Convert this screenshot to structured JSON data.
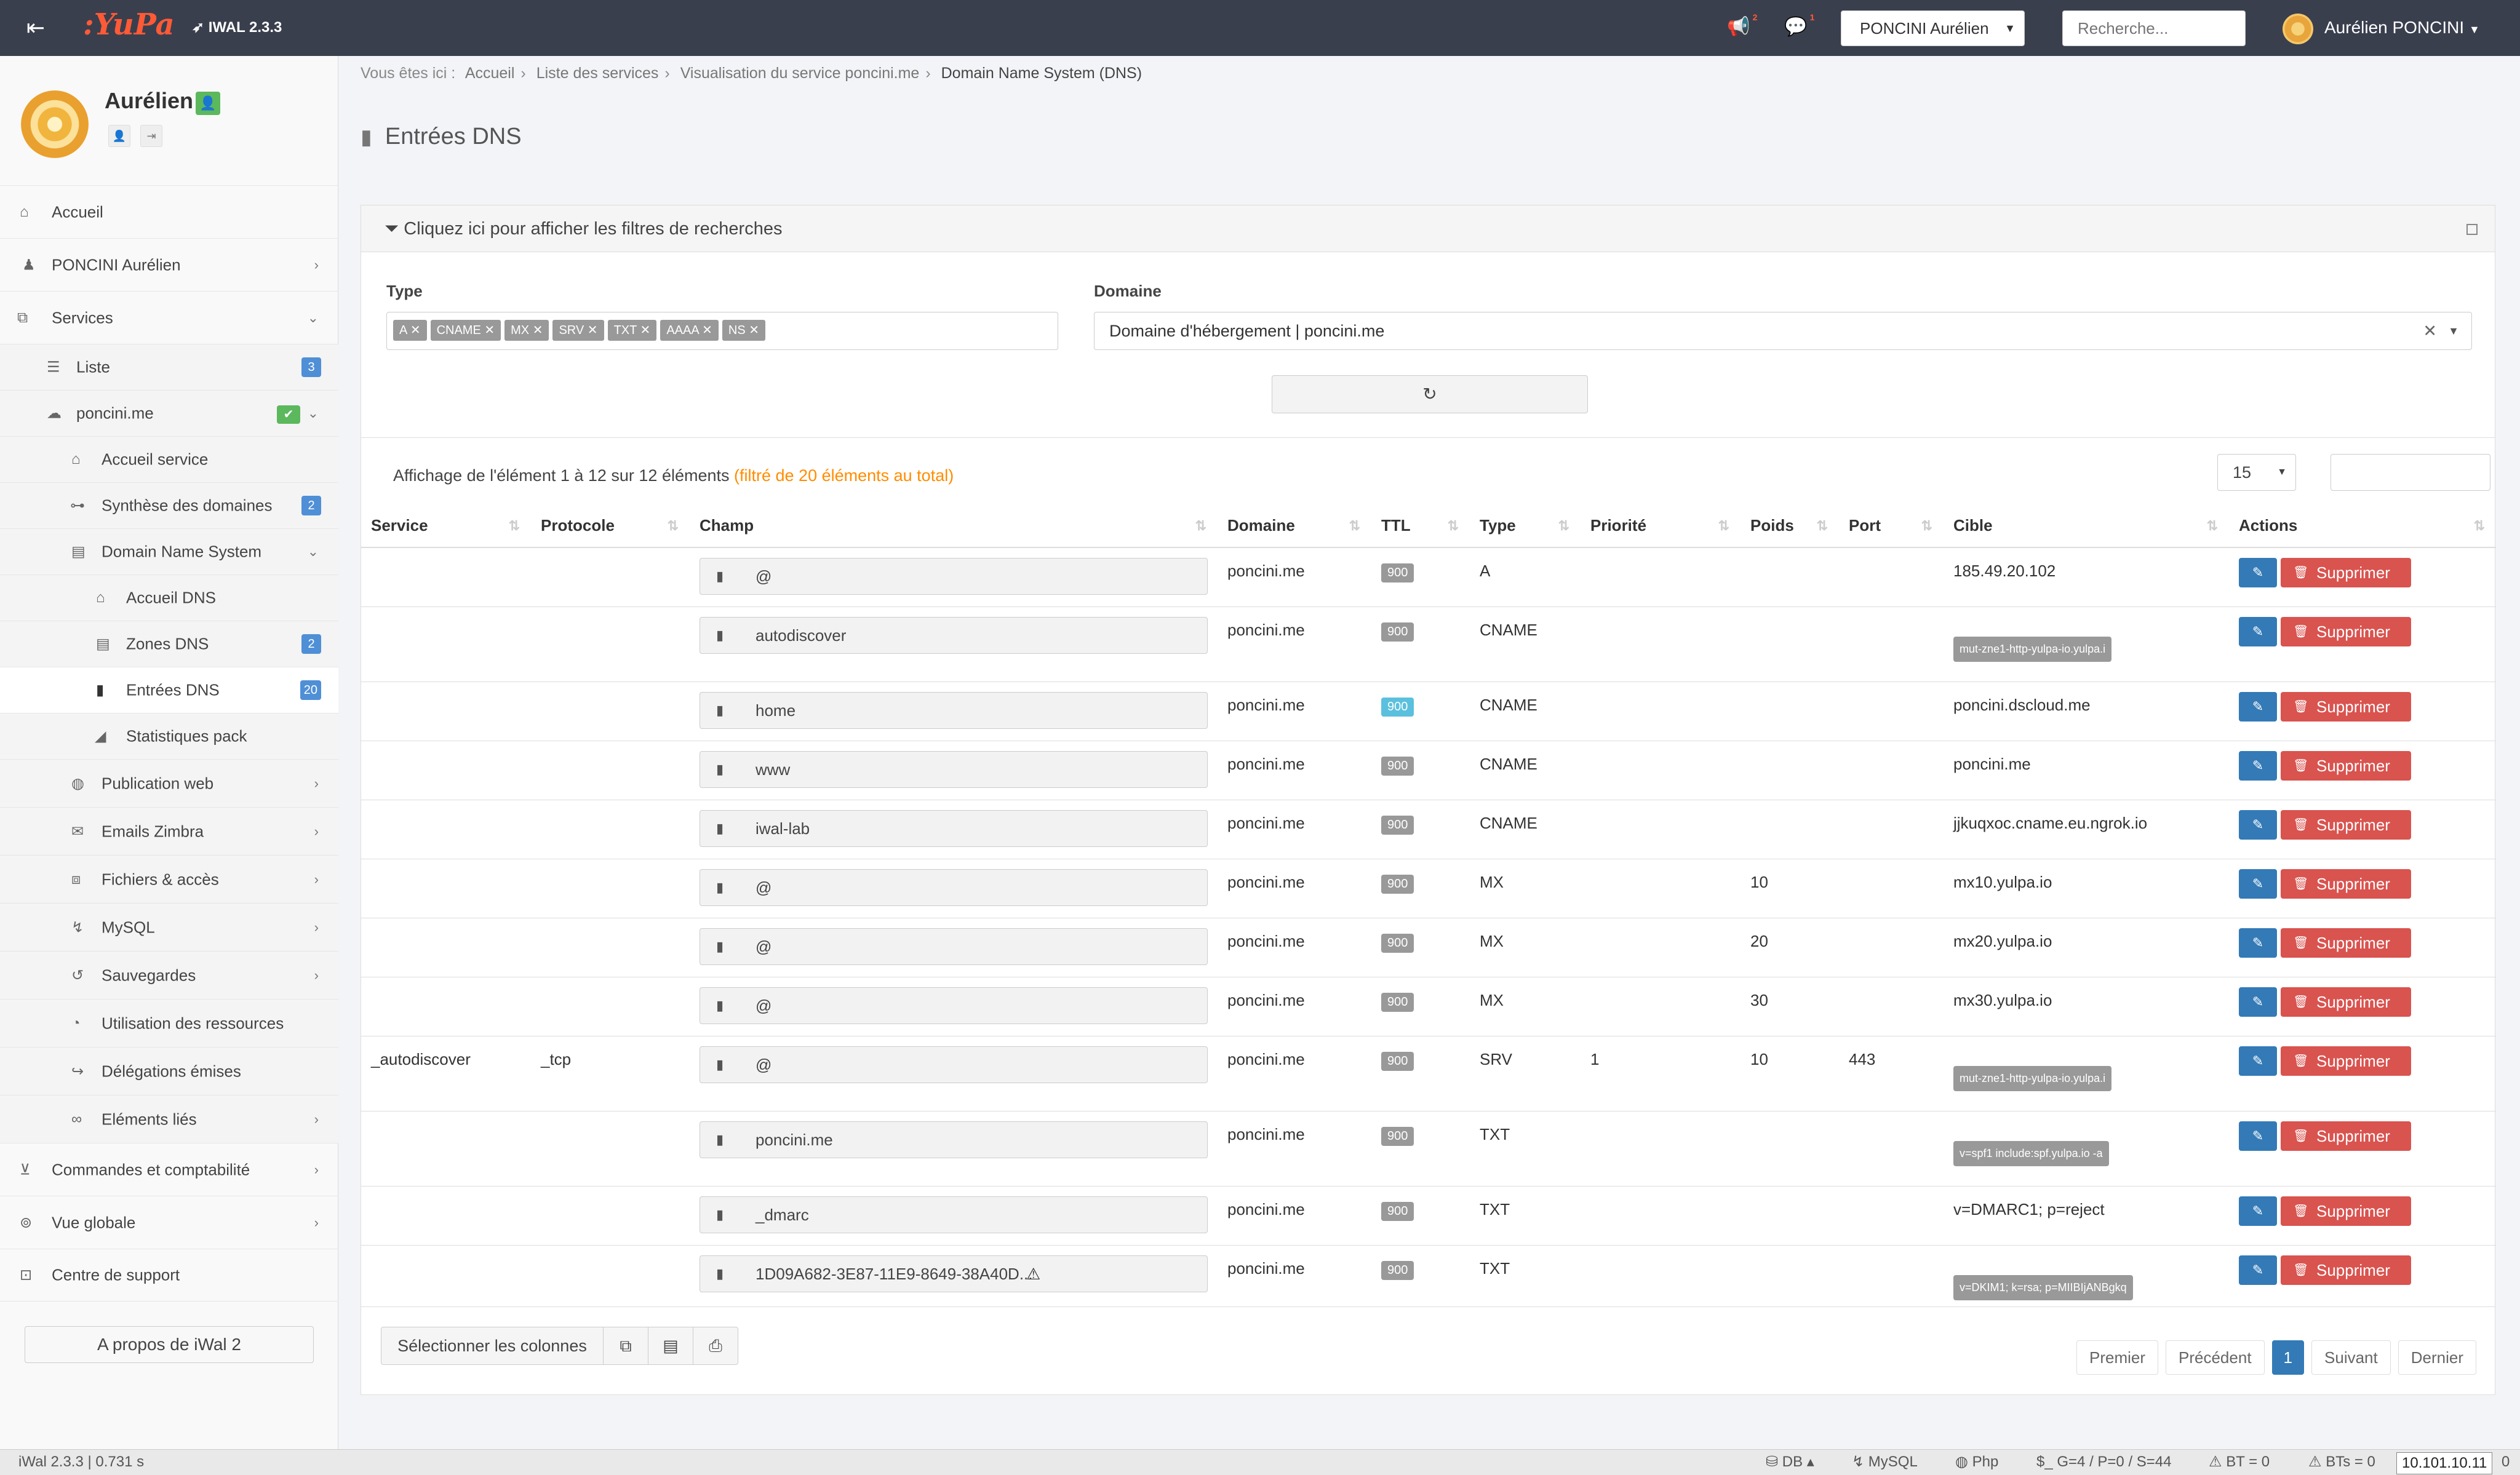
{
  "header": {
    "logo": ":YuPa",
    "version": "IWAL 2.3.3",
    "notif_count": "2",
    "chat_count": "1",
    "account_select": "PONCINI Aurélien",
    "search_placeholder": "Recherche...",
    "user_name": "Aurélien PONCINI"
  },
  "sidebar": {
    "profile_name": "Aurélien",
    "items": {
      "accueil": "Accueil",
      "poncini": "PONCINI Aurélien",
      "services": "Services",
      "liste": "Liste",
      "liste_count": "3",
      "poncinime": "poncini.me",
      "accueil_service": "Accueil service",
      "synthese": "Synthèse des domaines",
      "synthese_count": "2",
      "dns": "Domain Name System",
      "accueil_dns": "Accueil DNS",
      "zones": "Zones DNS",
      "zones_count": "2",
      "entrees": "Entrées DNS",
      "entrees_count": "20",
      "stats": "Statistiques pack",
      "publication": "Publication web",
      "emails": "Emails Zimbra",
      "fichiers": "Fichiers & accès",
      "mysql": "MySQL",
      "sauvegardes": "Sauvegardes",
      "ressources": "Utilisation des ressources",
      "delegations": "Délégations émises",
      "elements": "Eléments liés",
      "commandes": "Commandes et comptabilité",
      "vue": "Vue globale",
      "support": "Centre de support"
    },
    "about": "A propos de iWal 2"
  },
  "breadcrumb": {
    "prefix": "Vous êtes ici :",
    "items": [
      "Accueil",
      "Liste des services",
      "Visualisation du service poncini.me",
      "Domain Name System (DNS)"
    ]
  },
  "page_title": "Entrées DNS",
  "filters": {
    "toggle_label": "Cliquez ici pour afficher les filtres de recherches",
    "type_label": "Type",
    "type_tags": [
      "A",
      "CNAME",
      "MX",
      "SRV",
      "TXT",
      "AAAA",
      "NS"
    ],
    "domain_label": "Domaine",
    "domain_value": "Domaine d'hébergement | poncini.me"
  },
  "table": {
    "info": "Affichage de l'élément 1 à 12 sur 12 éléments",
    "info_filtered": "(filtré de 20 éléments au total)",
    "page_length": "15",
    "columns": [
      "Service",
      "Protocole",
      "Champ",
      "Domaine",
      "TTL",
      "Type",
      "Priorité",
      "Poids",
      "Port",
      "Cible",
      "Actions"
    ],
    "delete_label": "Supprimer",
    "rows": [
      {
        "service": "",
        "proto": "",
        "champ": "@",
        "domaine": "poncini.me",
        "ttl": "900",
        "type": "A",
        "prio": "",
        "poids": "",
        "port": "",
        "cible": "185.49.20.102",
        "cible_label": false
      },
      {
        "service": "",
        "proto": "",
        "champ": "autodiscover",
        "domaine": "poncini.me",
        "ttl": "900",
        "type": "CNAME",
        "prio": "",
        "poids": "",
        "port": "",
        "cible": "mut-zne1-http-yulpa-io.yulpa.i",
        "cible_label": true
      },
      {
        "service": "",
        "proto": "",
        "champ": "home",
        "domaine": "poncini.me",
        "ttl": "900",
        "type": "CNAME",
        "prio": "",
        "poids": "",
        "port": "",
        "cible": "poncini.dscloud.me",
        "cible_label": false,
        "ttl_hl": true
      },
      {
        "service": "",
        "proto": "",
        "champ": "www",
        "domaine": "poncini.me",
        "ttl": "900",
        "type": "CNAME",
        "prio": "",
        "poids": "",
        "port": "",
        "cible": "poncini.me",
        "cible_label": false
      },
      {
        "service": "",
        "proto": "",
        "champ": "iwal-lab",
        "domaine": "poncini.me",
        "ttl": "900",
        "type": "CNAME",
        "prio": "",
        "poids": "",
        "port": "",
        "cible": "jjkuqxoc.cname.eu.ngrok.io",
        "cible_label": false
      },
      {
        "service": "",
        "proto": "",
        "champ": "@",
        "domaine": "poncini.me",
        "ttl": "900",
        "type": "MX",
        "prio": "",
        "poids": "10",
        "port": "",
        "cible": "mx10.yulpa.io",
        "cible_label": false
      },
      {
        "service": "",
        "proto": "",
        "champ": "@",
        "domaine": "poncini.me",
        "ttl": "900",
        "type": "MX",
        "prio": "",
        "poids": "20",
        "port": "",
        "cible": "mx20.yulpa.io",
        "cible_label": false
      },
      {
        "service": "",
        "proto": "",
        "champ": "@",
        "domaine": "poncini.me",
        "ttl": "900",
        "type": "MX",
        "prio": "",
        "poids": "30",
        "port": "",
        "cible": "mx30.yulpa.io",
        "cible_label": false
      },
      {
        "service": "_autodiscover",
        "proto": "_tcp",
        "champ": "@",
        "domaine": "poncini.me",
        "ttl": "900",
        "type": "SRV",
        "prio": "1",
        "poids": "10",
        "port": "443",
        "cible": "mut-zne1-http-yulpa-io.yulpa.i",
        "cible_label": true
      },
      {
        "service": "",
        "proto": "",
        "champ": "poncini.me",
        "domaine": "poncini.me",
        "ttl": "900",
        "type": "TXT",
        "prio": "",
        "poids": "",
        "port": "",
        "cible": "v=spf1 include:spf.yulpa.io -a",
        "cible_label": true
      },
      {
        "service": "",
        "proto": "",
        "champ": "_dmarc",
        "domaine": "poncini.me",
        "ttl": "900",
        "type": "TXT",
        "prio": "",
        "poids": "",
        "port": "",
        "cible": "v=DMARC1; p=reject",
        "cible_label": false
      },
      {
        "service": "",
        "proto": "",
        "champ": "1D09A682-3E87-11E9-8649-38A40D...",
        "domaine": "poncini.me",
        "ttl": "900",
        "type": "TXT",
        "prio": "",
        "poids": "",
        "port": "",
        "cible": "v=DKIM1; k=rsa; p=MIIBIjANBgkq",
        "cible_label": true
      }
    ]
  },
  "footer_buttons": {
    "select_columns": "Sélectionner les colonnes"
  },
  "pager": {
    "first": "Premier",
    "prev": "Précédent",
    "current": "1",
    "next": "Suivant",
    "last": "Dernier"
  },
  "statusbar": {
    "version": "iWal 2.3.3 | 0.731 s",
    "db": "DB",
    "mysql": "MySQL",
    "php": "Php",
    "stats": "$_ G=4 / P=0 / S=44",
    "bt": "BT = 0",
    "bts": "BTs = 0",
    "ip": "10.101.10.11",
    "tail": "0"
  },
  "colors": {
    "header_bg": "#3a3f4e",
    "primary": "#337ab7",
    "danger": "#d9534f",
    "badge_blue": "#4f8fd6",
    "success": "#5cb85c",
    "filter_orange": "#ff8c00"
  }
}
